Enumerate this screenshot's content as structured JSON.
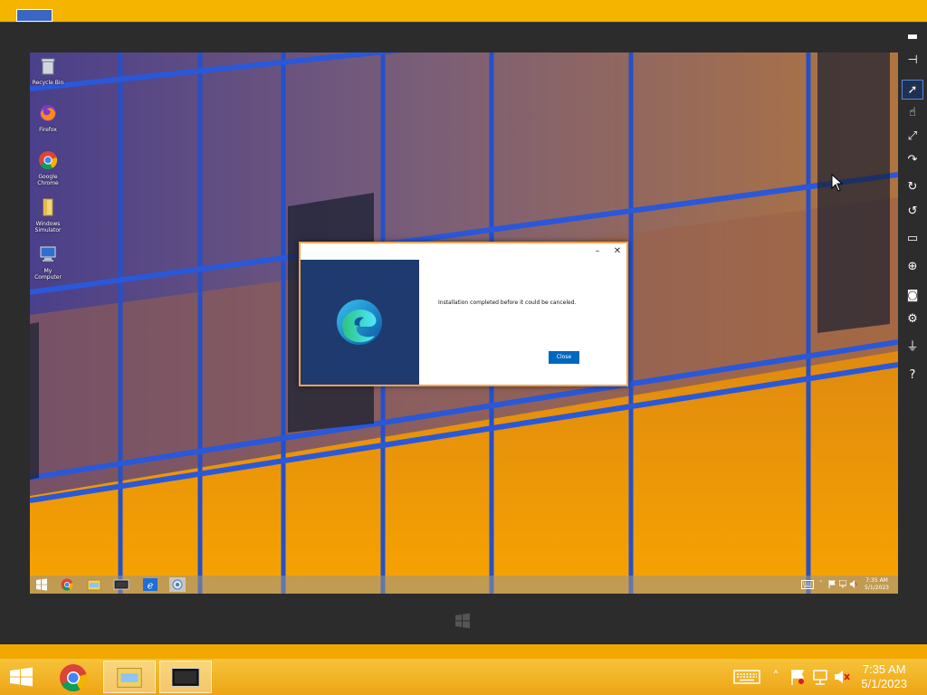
{
  "desktop_icons": [
    {
      "label": "Recycle Bin",
      "icon": "recycle-bin-icon"
    },
    {
      "label": "Firefox",
      "icon": "firefox-icon"
    },
    {
      "label": "Google Chrome",
      "icon": "chrome-icon"
    },
    {
      "label": "Windows Simulator",
      "icon": "folder-icon"
    },
    {
      "label": "My Computer",
      "icon": "computer-icon"
    }
  ],
  "dialog": {
    "message": "Installation completed before it could be canceled.",
    "close_button": "Close",
    "minimize_glyph": "–",
    "close_glyph": "✕"
  },
  "inner_taskbar": {
    "time": "7:35 AM",
    "date": "5/1/2023",
    "tray_chevron": "˄",
    "pinned": [
      "start-button",
      "chrome-icon",
      "file-explorer-icon",
      "simulator-icon",
      "internet-explorer-icon",
      "setup-icon"
    ]
  },
  "side_toolbar": {
    "tools": [
      {
        "name": "minimize-tool",
        "glyph": "▬"
      },
      {
        "name": "pin-tool",
        "glyph": "⊣"
      },
      {
        "name": "mouse-mode-tool",
        "glyph": "➚",
        "active": true
      },
      {
        "name": "touch-mode-tool",
        "glyph": "☝"
      },
      {
        "name": "pinch-zoom-tool",
        "glyph": "⤢"
      },
      {
        "name": "rotation-mode-tool",
        "glyph": "↷"
      },
      {
        "name": "rotate-clockwise-tool",
        "glyph": "↻"
      },
      {
        "name": "rotate-counterclockwise-tool",
        "glyph": "↺"
      },
      {
        "name": "resolution-tool",
        "glyph": "▭"
      },
      {
        "name": "location-tool",
        "glyph": "⊕"
      },
      {
        "name": "screenshot-tool",
        "glyph": "◙"
      },
      {
        "name": "settings-tool",
        "glyph": "⚙"
      },
      {
        "name": "network-tool",
        "glyph": "⏚"
      },
      {
        "name": "help-tool",
        "glyph": "?"
      }
    ]
  },
  "host_taskbar": {
    "time": "7:35 AM",
    "date": "5/1/2023",
    "tray_chevron": "˄",
    "pinned": [
      "start-button",
      "chrome-icon",
      "file-explorer-icon",
      "simulator-icon"
    ]
  },
  "colors": {
    "accent_button": "#0067c0",
    "dialog_panel": "#1f3a6e",
    "host_taskbar": "#f0b020"
  }
}
